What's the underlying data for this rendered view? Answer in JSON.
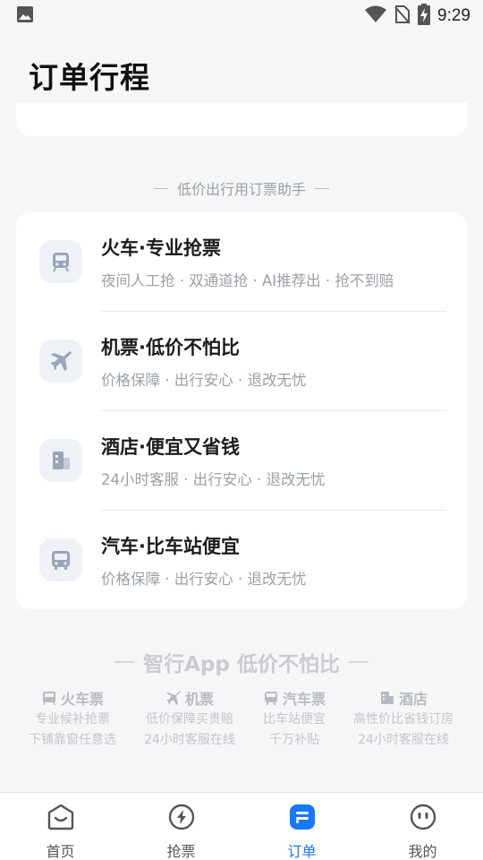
{
  "status_bar": {
    "time": "9:29"
  },
  "page": {
    "title": "订单行程"
  },
  "section_helper": {
    "label": "低价出行用订票助手"
  },
  "services": [
    {
      "icon": "train-icon",
      "title": "火车·专业抢票",
      "desc": "夜间人工抢 · 双通道抢 · AI推荐出 · 抢不到赔"
    },
    {
      "icon": "plane-icon",
      "title": "机票·低价不怕比",
      "desc": "价格保障 · 出行安心 · 退改无忧"
    },
    {
      "icon": "hotel-icon",
      "title": "酒店·便宜又省钱",
      "desc": "24小时客服 · 出行安心 · 退改无忧"
    },
    {
      "icon": "bus-icon",
      "title": "汽车·比车站便宜",
      "desc": "价格保障 · 出行安心 · 退改无忧"
    }
  ],
  "slogan": "智行App 低价不怕比",
  "features": [
    {
      "icon": "train-ticket-icon",
      "title": "火车票",
      "line1": "专业候补抢票",
      "line2": "下铺靠窗任意选"
    },
    {
      "icon": "plane-icon",
      "title": "机票",
      "line1": "低价保障买贵赔",
      "line2": "24小时客服在线"
    },
    {
      "icon": "bus-icon",
      "title": "汽车票",
      "line1": "比车站便宜",
      "line2": "千万补贴"
    },
    {
      "icon": "hotel-icon",
      "title": "酒店",
      "line1": "高性价比省钱订房",
      "line2": "24小时客服在线"
    }
  ],
  "tabs": [
    {
      "label": "首页",
      "icon": "home-icon",
      "active": false
    },
    {
      "label": "抢票",
      "icon": "flash-icon",
      "active": false
    },
    {
      "label": "订单",
      "icon": "order-icon",
      "active": true
    },
    {
      "label": "我的",
      "icon": "profile-icon",
      "active": false
    }
  ],
  "colors": {
    "accent": "#1677ff",
    "background": "#f5f6f8",
    "muted_text": "#9aa0a8"
  }
}
